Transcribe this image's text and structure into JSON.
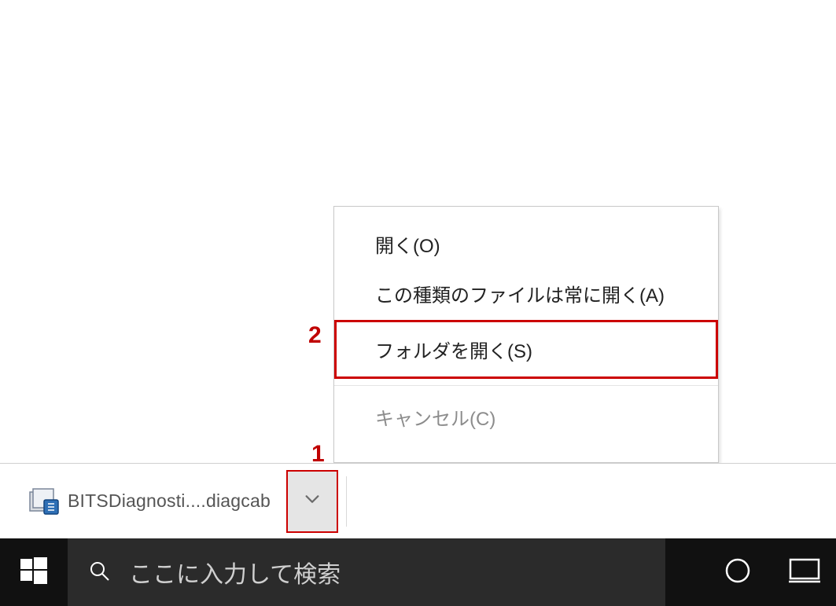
{
  "download_bar": {
    "file_name": "BITSDiagnosti....diagcab"
  },
  "context_menu": {
    "open": "開く(O)",
    "always_open": "この種類のファイルは常に開く(A)",
    "show_in_folder": "フォルダを開く(S)",
    "cancel": "キャンセル(C)"
  },
  "taskbar": {
    "search_placeholder": "ここに入力して検索"
  },
  "annotations": {
    "one": "1",
    "two": "2"
  }
}
